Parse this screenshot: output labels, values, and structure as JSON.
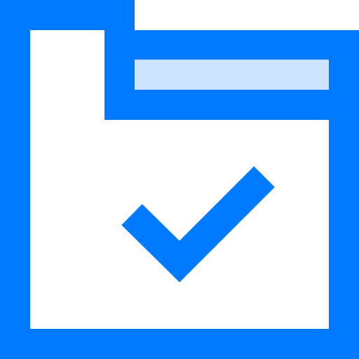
{
  "icon": {
    "name": "folder-check-icon",
    "colors": {
      "primary": "#007BFF",
      "tab_highlight": "#CCE3FF",
      "background": "#FFFFFF"
    }
  }
}
